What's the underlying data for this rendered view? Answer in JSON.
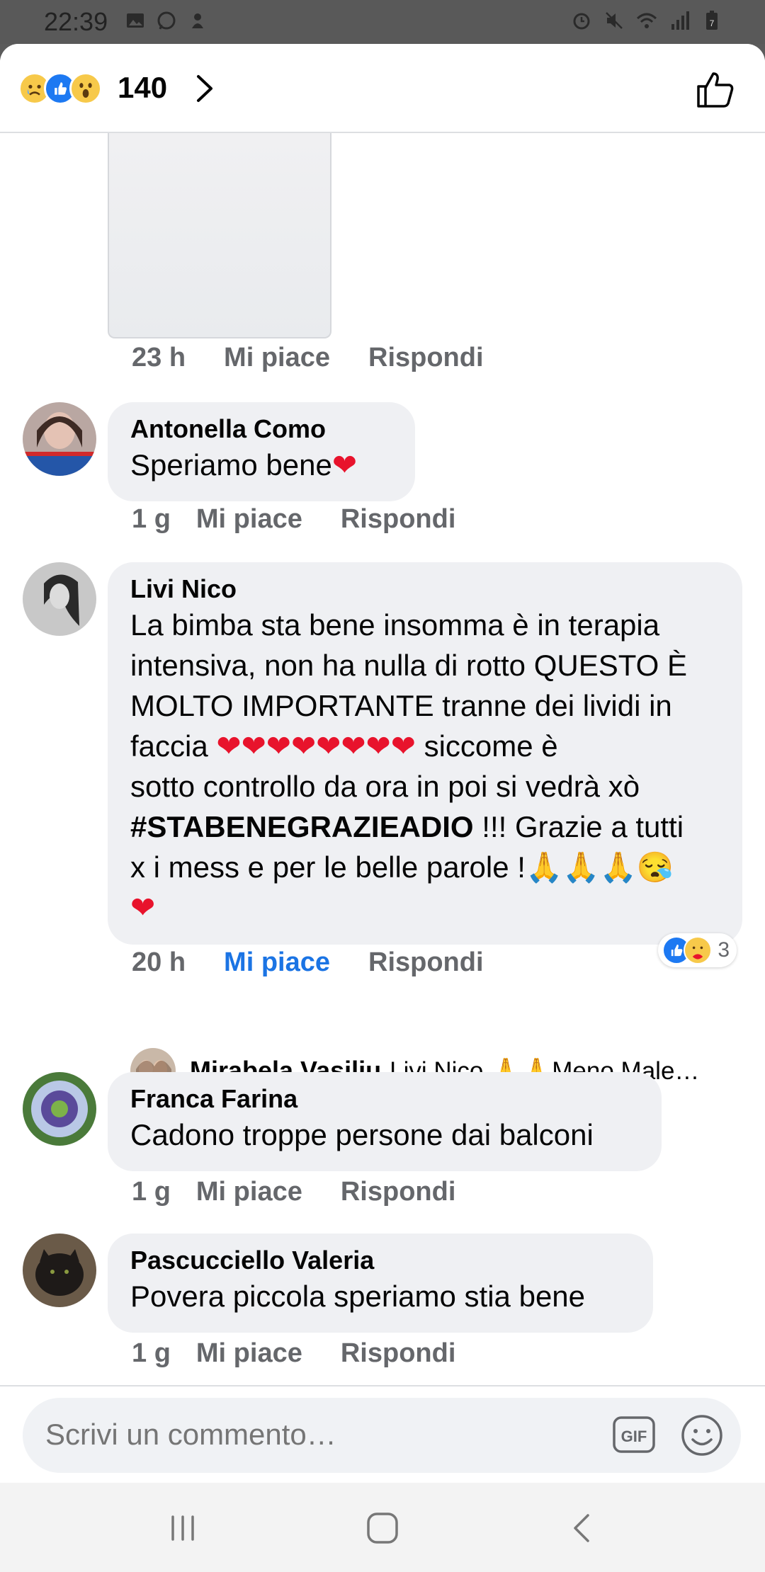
{
  "status_bar": {
    "time": "22:39",
    "battery_level": "7"
  },
  "header": {
    "reaction_count": "140",
    "reactions": [
      "sad-icon",
      "like-icon",
      "wow-icon"
    ]
  },
  "first_post_meta": {
    "time": "23 h",
    "like": "Mi piace",
    "reply": "Rispondi"
  },
  "comments": [
    {
      "author": "Antonella Como",
      "text": "Speriamo bene",
      "emoji": "❤",
      "time": "1 g",
      "like": "Mi piace",
      "reply": "Rispondi"
    },
    {
      "author": "Livi Nico",
      "line1": "La bimba sta bene insomma è in terapia",
      "line2": "intensiva, non ha nulla di rotto QUESTO È",
      "line3": "MOLTO IMPORTANTE  tranne dei lividi in",
      "line4_a": "faccia ",
      "line4_hearts": "❤❤❤❤❤❤❤❤",
      "line4_b": "  siccome è",
      "line5": "sotto controllo da ora in poi si vedrà xò",
      "line6_hashtag": "#STABENEGRAZIEADIO",
      "line6_b": " !!! Grazie a tutti",
      "line7": "x i mess e per le belle parole !",
      "line7_pray": "🙏🙏🙏",
      "line7_face": "😪",
      "line8_heart": "❤",
      "time": "20 h",
      "like": "Mi piace",
      "reply": "Rispondi",
      "reaction_count": "3",
      "reply_preview": {
        "author": "Mirabela Vasiliu",
        "text": "Livi Nico 🙏🙏Meno Male…"
      }
    },
    {
      "author": "Franca Farina",
      "text": "Cadono troppe persone dai balconi",
      "time": "1 g",
      "like": "Mi piace",
      "reply": "Rispondi"
    },
    {
      "author": "Pascucciello Valeria",
      "text": "Povera piccola speriamo stia bene",
      "time": "1 g",
      "like": "Mi piace",
      "reply": "Rispondi"
    }
  ],
  "composer": {
    "placeholder": "Scrivi un commento…",
    "gif_label": "GIF"
  },
  "colors": {
    "link_blue": "#1b74e4",
    "bubble_bg": "#eff0f3",
    "meta_gray": "#65676b",
    "heart_red": "#e8132c"
  }
}
